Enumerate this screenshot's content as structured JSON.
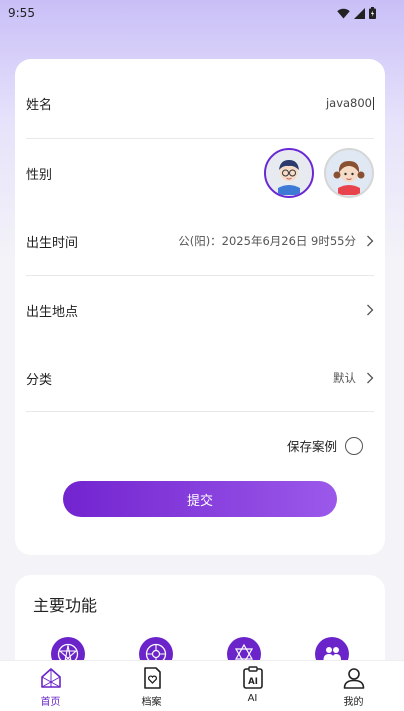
{
  "status_bar": {
    "time": "9:55"
  },
  "form": {
    "name": {
      "label": "姓名",
      "value": "java800"
    },
    "gender": {
      "label": "性别",
      "selected": "boy"
    },
    "birth_time": {
      "label": "出生时间",
      "value": "公(阳)：2025年6月26日 9时55分"
    },
    "birth_place": {
      "label": "出生地点",
      "value": ""
    },
    "category": {
      "label": "分类",
      "value": "默认"
    },
    "save_case": {
      "label": "保存案例",
      "checked": false
    },
    "submit_label": "提交"
  },
  "features": {
    "title": "主要功能",
    "items": [
      {
        "icon": "pentagram-circle-icon"
      },
      {
        "icon": "wheel-icon"
      },
      {
        "icon": "hexagram-icon"
      },
      {
        "icon": "group-icon"
      }
    ]
  },
  "tabs": [
    {
      "label": "首页",
      "icon": "home-icon",
      "active": true
    },
    {
      "label": "档案",
      "icon": "file-heart-icon",
      "active": false
    },
    {
      "label": "AI",
      "icon": "ai-clipboard-icon",
      "active": false
    },
    {
      "label": "我的",
      "icon": "user-icon",
      "active": false
    }
  ],
  "colors": {
    "accent": "#6a24c9",
    "accent_light": "#9b59ea"
  }
}
